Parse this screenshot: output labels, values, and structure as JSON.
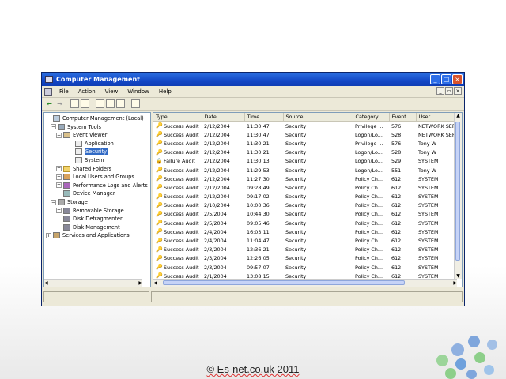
{
  "window": {
    "title": "Computer Management",
    "controls": {
      "minimize": "_",
      "maximize": "□",
      "close": "×"
    }
  },
  "menu": [
    "File",
    "Action",
    "View",
    "Window",
    "Help"
  ],
  "child_controls": {
    "minimize": "_",
    "restore": "▫",
    "close": "×"
  },
  "toolbar": {
    "back": "←",
    "forward": "→"
  },
  "tree": [
    {
      "label": "Computer Management (Local)",
      "icon": "computer-icon",
      "expander": ""
    },
    {
      "label": "System Tools",
      "icon": "tools-icon",
      "expander": "−"
    },
    {
      "label": "Event Viewer",
      "icon": "event-viewer-icon",
      "expander": "−"
    },
    {
      "label": "Application",
      "icon": "log-icon",
      "expander": ""
    },
    {
      "label": "Security",
      "icon": "log-icon",
      "expander": "",
      "selected": true
    },
    {
      "label": "System",
      "icon": "log-icon",
      "expander": ""
    },
    {
      "label": "Shared Folders",
      "icon": "folder-icon",
      "expander": "+"
    },
    {
      "label": "Local Users and Groups",
      "icon": "users-icon",
      "expander": "+"
    },
    {
      "label": "Performance Logs and Alerts",
      "icon": "performance-icon",
      "expander": "+"
    },
    {
      "label": "Device Manager",
      "icon": "device-manager-icon",
      "expander": ""
    },
    {
      "label": "Storage",
      "icon": "storage-icon",
      "expander": "−"
    },
    {
      "label": "Removable Storage",
      "icon": "removable-storage-icon",
      "expander": "+"
    },
    {
      "label": "Disk Defragmenter",
      "icon": "defrag-icon",
      "expander": ""
    },
    {
      "label": "Disk Management",
      "icon": "disk-icon",
      "expander": ""
    },
    {
      "label": "Services and Applications",
      "icon": "services-icon",
      "expander": "+"
    }
  ],
  "columns": [
    "Type",
    "Date",
    "Time",
    "Source",
    "Category",
    "Event",
    "User"
  ],
  "events": [
    {
      "type": "Success Audit",
      "date": "2/12/2004",
      "time": "11:30:47",
      "source": "Security",
      "category": "Privilege ...",
      "event": "576",
      "user": "NETWORK SER"
    },
    {
      "type": "Success Audit",
      "date": "2/12/2004",
      "time": "11:30:47",
      "source": "Security",
      "category": "Logon/Lo...",
      "event": "528",
      "user": "NETWORK SER"
    },
    {
      "type": "Success Audit",
      "date": "2/12/2004",
      "time": "11:30:21",
      "source": "Security",
      "category": "Privilege ...",
      "event": "576",
      "user": "Tony W"
    },
    {
      "type": "Success Audit",
      "date": "2/12/2004",
      "time": "11:30:21",
      "source": "Security",
      "category": "Logon/Lo...",
      "event": "528",
      "user": "Tony W"
    },
    {
      "type": "Failure Audit",
      "date": "2/12/2004",
      "time": "11:30:13",
      "source": "Security",
      "category": "Logon/Lo...",
      "event": "529",
      "user": "SYSTEM"
    },
    {
      "type": "Success Audit",
      "date": "2/12/2004",
      "time": "11:29:53",
      "source": "Security",
      "category": "Logon/Lo...",
      "event": "551",
      "user": "Tony W"
    },
    {
      "type": "Success Audit",
      "date": "2/12/2004",
      "time": "11:27:30",
      "source": "Security",
      "category": "Policy Ch...",
      "event": "612",
      "user": "SYSTEM"
    },
    {
      "type": "Success Audit",
      "date": "2/12/2004",
      "time": "09:28:49",
      "source": "Security",
      "category": "Policy Ch...",
      "event": "612",
      "user": "SYSTEM"
    },
    {
      "type": "Success Audit",
      "date": "2/12/2004",
      "time": "09:17:02",
      "source": "Security",
      "category": "Policy Ch...",
      "event": "612",
      "user": "SYSTEM"
    },
    {
      "type": "Success Audit",
      "date": "2/10/2004",
      "time": "10:00:36",
      "source": "Security",
      "category": "Policy Ch...",
      "event": "612",
      "user": "SYSTEM"
    },
    {
      "type": "Success Audit",
      "date": "2/5/2004",
      "time": "10:44:30",
      "source": "Security",
      "category": "Policy Ch...",
      "event": "612",
      "user": "SYSTEM"
    },
    {
      "type": "Success Audit",
      "date": "2/5/2004",
      "time": "09:05:46",
      "source": "Security",
      "category": "Policy Ch...",
      "event": "612",
      "user": "SYSTEM"
    },
    {
      "type": "Success Audit",
      "date": "2/4/2004",
      "time": "16:03:11",
      "source": "Security",
      "category": "Policy Ch...",
      "event": "612",
      "user": "SYSTEM"
    },
    {
      "type": "Success Audit",
      "date": "2/4/2004",
      "time": "11:04:47",
      "source": "Security",
      "category": "Policy Ch...",
      "event": "612",
      "user": "SYSTEM"
    },
    {
      "type": "Success Audit",
      "date": "2/3/2004",
      "time": "12:36:21",
      "source": "Security",
      "category": "Policy Ch...",
      "event": "612",
      "user": "SYSTEM"
    },
    {
      "type": "Success Audit",
      "date": "2/3/2004",
      "time": "12:26:05",
      "source": "Security",
      "category": "Policy Ch...",
      "event": "612",
      "user": "SYSTEM"
    },
    {
      "type": "Success Audit",
      "date": "2/3/2004",
      "time": "09:57:07",
      "source": "Security",
      "category": "Policy Ch...",
      "event": "612",
      "user": "SYSTEM"
    },
    {
      "type": "Success Audit",
      "date": "2/1/2004",
      "time": "13:08:15",
      "source": "Security",
      "category": "Policy Ch...",
      "event": "612",
      "user": "SYSTEM"
    }
  ],
  "footer": {
    "copyright": "© Es-net.co.uk 2011"
  },
  "colors": {
    "titlebar": "#1347c6",
    "selection": "#316ac5",
    "decor_blue": "#7fa6dc",
    "decor_green": "#8dcf8a"
  }
}
